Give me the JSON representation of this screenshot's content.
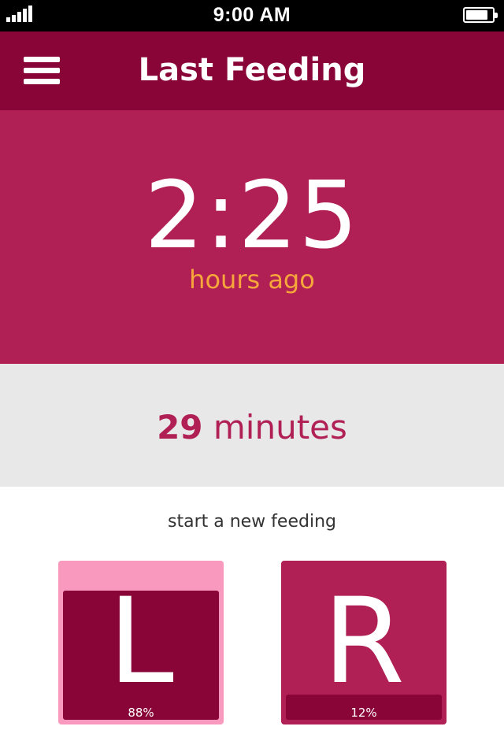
{
  "status_bar": {
    "time": "9:00 AM",
    "signal_icon": "signal-bars-icon",
    "battery_icon": "battery-icon",
    "battery_level": 0.85
  },
  "header": {
    "menu_icon": "hamburger-menu-icon",
    "title": "Last Feeding"
  },
  "last_feeding": {
    "elapsed": "2:25",
    "unit": "hours ago"
  },
  "duration": {
    "value": "29",
    "unit": "minutes"
  },
  "new_feeding": {
    "label": "start a new feeding",
    "sides": [
      {
        "letter": "L",
        "percent_label": "88%",
        "percent": 88
      },
      {
        "letter": "R",
        "percent_label": "12%",
        "percent": 12
      }
    ]
  },
  "colors": {
    "header_bg": "#890537",
    "hero_bg": "#b02054",
    "accent_orange": "#f6a63a",
    "light_pink": "#f899bd",
    "duration_bg": "#e8e8e8"
  }
}
